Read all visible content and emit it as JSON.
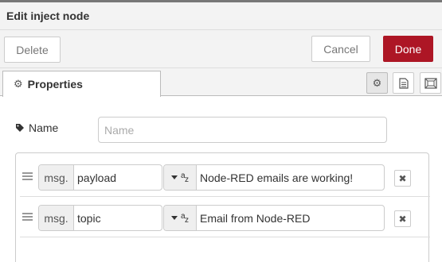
{
  "window": {
    "title": "Edit inject node"
  },
  "toolbar": {
    "delete_label": "Delete",
    "cancel_label": "Cancel",
    "done_label": "Done"
  },
  "tabs": [
    {
      "label": "Properties",
      "icon": "gear-icon"
    }
  ],
  "tab_actions": [
    {
      "icon": "gear-icon",
      "active": true
    },
    {
      "icon": "document-icon",
      "active": false
    },
    {
      "icon": "frame-icon",
      "active": false
    }
  ],
  "form": {
    "name_label": "Name",
    "name_placeholder": "Name",
    "name_value": ""
  },
  "properties": [
    {
      "prefix": "msg.",
      "property": "payload",
      "operator": "=",
      "type_icon": "string-type-icon",
      "value": "Node-RED emails are working!"
    },
    {
      "prefix": "msg.",
      "property": "topic",
      "operator": "=",
      "type_icon": "string-type-icon",
      "value": "Email from Node-RED"
    }
  ],
  "colors": {
    "done_button": "#ad1625",
    "header_bg": "#f3f3f3"
  }
}
